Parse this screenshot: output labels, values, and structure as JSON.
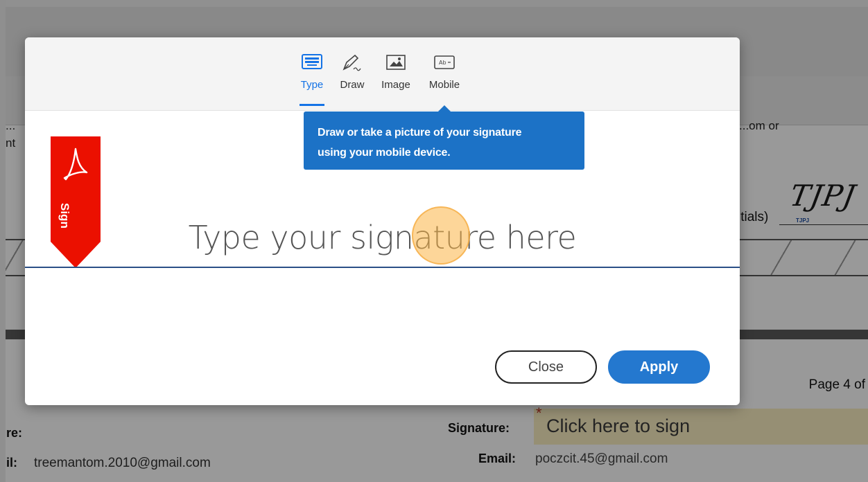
{
  "document": {
    "page_label": "Page 4 of",
    "initials_label": "itials)",
    "initials_signature": "TJPJ",
    "initials_small": "TJPJ",
    "peek_left_1": "...",
    "peek_left_2": "nt",
    "peek_right": "...om or",
    "signer_left": {
      "signature_label": "re:",
      "email_label": "il:",
      "email_value": "treemantom.2010@gmail.com"
    },
    "signer_right": {
      "signature_label": "Signature:",
      "sign_field_text": "Click here to sign",
      "required_mark": "*",
      "email_label": "Email:",
      "email_value": "poczcit.45@gmail.com"
    }
  },
  "dialog": {
    "tabs": [
      {
        "label": "Type",
        "icon": "keyboard-icon",
        "active": true
      },
      {
        "label": "Draw",
        "icon": "pen-icon",
        "active": false
      },
      {
        "label": "Image",
        "icon": "image-icon",
        "active": false
      },
      {
        "label": "Mobile",
        "icon": "mobile-icon",
        "active": false
      }
    ],
    "tooltip": {
      "line1": "Draw or take a picture of your signature",
      "line2": "using your mobile device."
    },
    "badge_label": "Sign",
    "signature_placeholder": "Type your signature here",
    "close_label": "Close",
    "apply_label": "Apply"
  },
  "colors": {
    "accent": "#1473e6",
    "tooltip_bg": "#1c72c6",
    "badge_red": "#eb1000",
    "apply_bg": "#2478cf",
    "sign_field_bg": "#fbeec1"
  }
}
